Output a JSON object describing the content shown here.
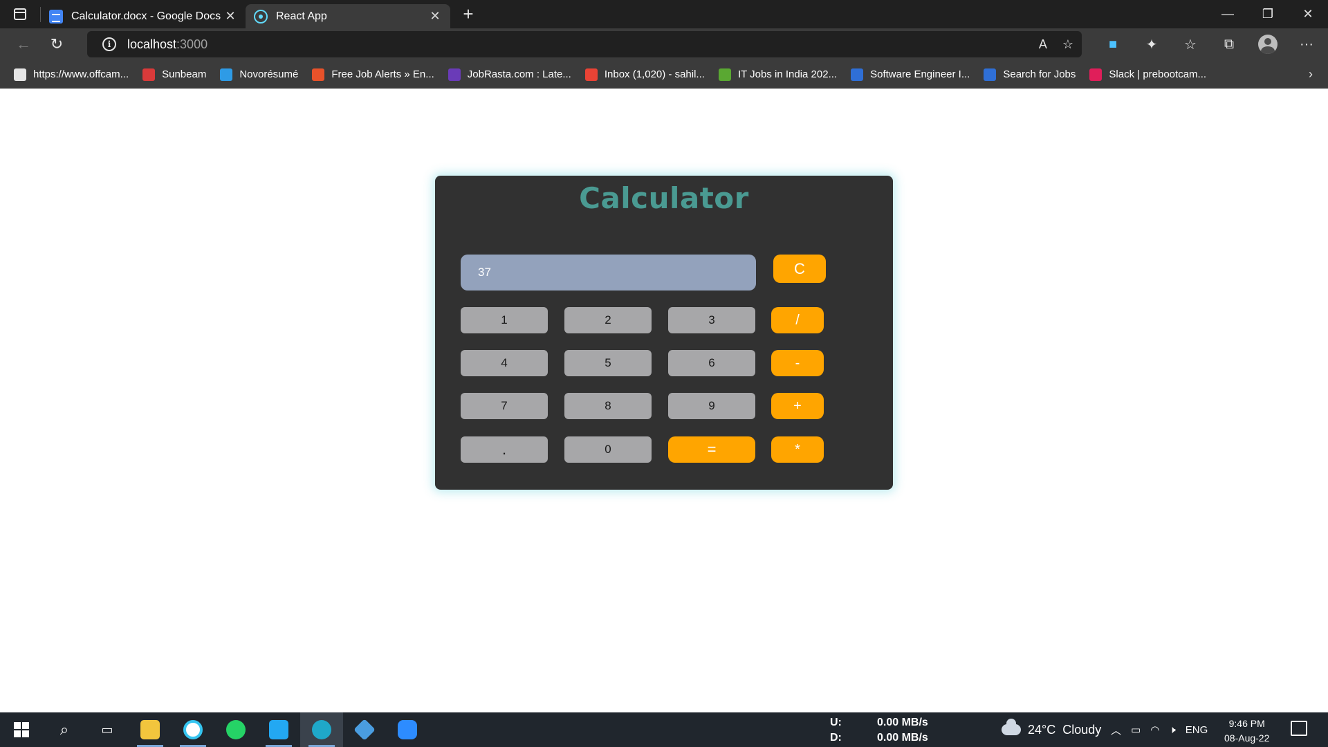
{
  "browser": {
    "tabs": [
      {
        "label": "Calculator.docx - Google Docs",
        "icon": "google-docs-icon",
        "active": false
      },
      {
        "label": "React App",
        "icon": "react-icon",
        "active": true
      }
    ],
    "new_tab_symbol": "+",
    "tab_close_symbol": "✕",
    "window_controls": {
      "minimize": "—",
      "restore": "❐",
      "close": "✕"
    },
    "address": {
      "host": "localhost",
      "port": ":3000"
    },
    "nav": {
      "back": "←",
      "refresh": "↻"
    },
    "favorites": [
      {
        "label": "https://www.offcam...",
        "color": "#e6e6e6"
      },
      {
        "label": "Sunbeam",
        "color": "#d93a3a"
      },
      {
        "label": "Novorésumé",
        "color": "#2e9be6"
      },
      {
        "label": "Free Job Alerts » En...",
        "color": "#e8522a"
      },
      {
        "label": "JobRasta.com : Late...",
        "color": "#6a3bb8"
      },
      {
        "label": "Inbox (1,020) - sahil...",
        "color": "#ea4335"
      },
      {
        "label": "IT Jobs in India 202...",
        "color": "#5aa832"
      },
      {
        "label": "Software Engineer I...",
        "color": "#2f6fd6"
      },
      {
        "label": "Search for Jobs",
        "color": "#2f6fd6"
      },
      {
        "label": "Slack | prebootcam...",
        "color": "#e01e5a"
      }
    ],
    "favorites_more": "›"
  },
  "calculator": {
    "title": "Calculator",
    "display_value": "37",
    "clear_label": "C",
    "keys": {
      "k1": "1",
      "k2": "2",
      "k3": "3",
      "div": "/",
      "k4": "4",
      "k5": "5",
      "k6": "6",
      "sub": "-",
      "k7": "7",
      "k8": "8",
      "k9": "9",
      "add": "+",
      "dot": ".",
      "k0": "0",
      "eq": "=",
      "mul": "*"
    },
    "colors": {
      "panel": "#313131",
      "title": "#4a9a92",
      "display": "#93a2bc",
      "number_key": "#a7a7a9",
      "operator_key": "#ffa500"
    }
  },
  "taskbar": {
    "net": {
      "up_label": "U:",
      "up_value": "0.00 MB/s",
      "down_label": "D:",
      "down_value": "0.00 MB/s"
    },
    "weather": "24°C  Cloudy",
    "language": "ENG",
    "time": "9:46 PM",
    "date": "08-Aug-22"
  }
}
